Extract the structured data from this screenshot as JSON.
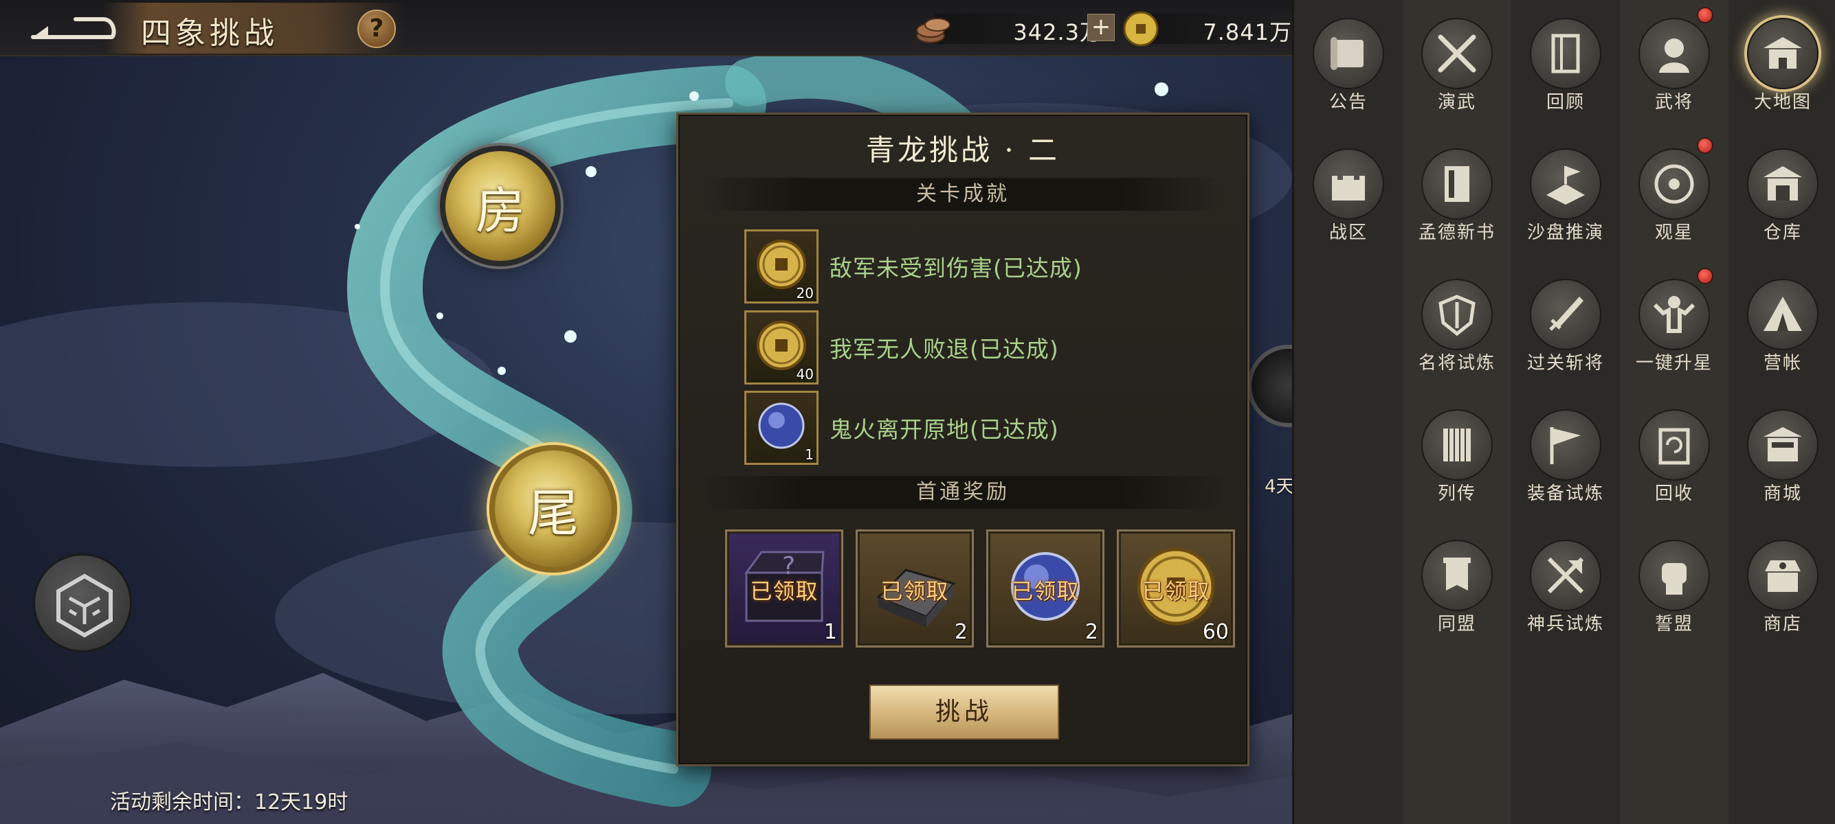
{
  "header": {
    "title": "四象挑战",
    "help_label": "?",
    "currency": {
      "copper": {
        "icon": "copper-coins-icon",
        "value": "342.3万",
        "add_label": "+"
      },
      "gold": {
        "icon": "gold-coin-icon",
        "value": "7.841万"
      }
    }
  },
  "stages": {
    "fang": "房",
    "wei": "尾",
    "partial_days": "4天"
  },
  "event": {
    "remaining_label": "活动剩余时间：12天19时"
  },
  "modal": {
    "title": "青龙挑战 · 二",
    "achievement_header": "关卡成就",
    "achievements": [
      {
        "icon": "gold-coin-icon",
        "count": "20",
        "text": "敌军未受到伤害(已达成)"
      },
      {
        "icon": "gold-coin-icon",
        "count": "40",
        "text": "我军无人败退(已达成)"
      },
      {
        "icon": "blue-orb-icon",
        "count": "1",
        "text": "鬼火离开原地(已达成)"
      }
    ],
    "first_clear_header": "首通奖励",
    "rewards": [
      {
        "icon": "mystery-chest-icon",
        "status": "已领取",
        "count": "1"
      },
      {
        "icon": "iron-ingot-icon",
        "status": "已领取",
        "count": "2"
      },
      {
        "icon": "blue-orb-icon",
        "status": "已领取",
        "count": "2"
      },
      {
        "icon": "gold-coin-icon",
        "status": "已领取",
        "count": "60"
      }
    ],
    "challenge_label": "挑战"
  },
  "menu": {
    "items": [
      {
        "id": "notice",
        "label": "公告",
        "icon": "scroll-icon"
      },
      {
        "id": "drill",
        "label": "演武",
        "icon": "crossed-swords-icon"
      },
      {
        "id": "review",
        "label": "回顾",
        "icon": "book-icon"
      },
      {
        "id": "generals",
        "label": "武将",
        "icon": "general-icon",
        "badge": true
      },
      {
        "id": "map",
        "label": "大地图",
        "icon": "palace-icon"
      },
      {
        "id": "zone",
        "label": "战区",
        "icon": "castle-icon"
      },
      {
        "id": "mengde",
        "label": "孟德新书",
        "icon": "manual-icon"
      },
      {
        "id": "sandtable",
        "label": "沙盘推演",
        "icon": "sand-table-icon"
      },
      {
        "id": "stargaze",
        "label": "观星",
        "icon": "astrolabe-icon",
        "badge": true
      },
      {
        "id": "warehouse",
        "label": "仓库",
        "icon": "warehouse-icon"
      },
      {
        "id": "famous",
        "label": "名将试炼",
        "icon": "shield-sword-icon"
      },
      {
        "id": "passes",
        "label": "过关斩将",
        "icon": "blade-icon"
      },
      {
        "id": "starup",
        "label": "一键升星",
        "icon": "strongman-icon",
        "badge": true
      },
      {
        "id": "camp",
        "label": "营帐",
        "icon": "tent-icon"
      },
      {
        "id": "biography",
        "label": "列传",
        "icon": "scroll-roll-icon"
      },
      {
        "id": "equiptrial",
        "label": "装备试炼",
        "icon": "flag-icon"
      },
      {
        "id": "recycle",
        "label": "回收",
        "icon": "recycle-icon"
      },
      {
        "id": "mall",
        "label": "商城",
        "icon": "shop-building-icon"
      },
      {
        "id": "alliance",
        "label": "同盟",
        "icon": "banner-icon"
      },
      {
        "id": "divinetrial",
        "label": "神兵试炼",
        "icon": "divine-weapon-icon"
      },
      {
        "id": "oath",
        "label": "誓盟",
        "icon": "fist-icon"
      },
      {
        "id": "store",
        "label": "商店",
        "icon": "market-icon"
      }
    ]
  },
  "colors": {
    "achievement_text": "#a9d28a",
    "claimed_text": "#f8d080",
    "accent_gold": "#d7bd5c",
    "badge_red": "#b0201a"
  }
}
